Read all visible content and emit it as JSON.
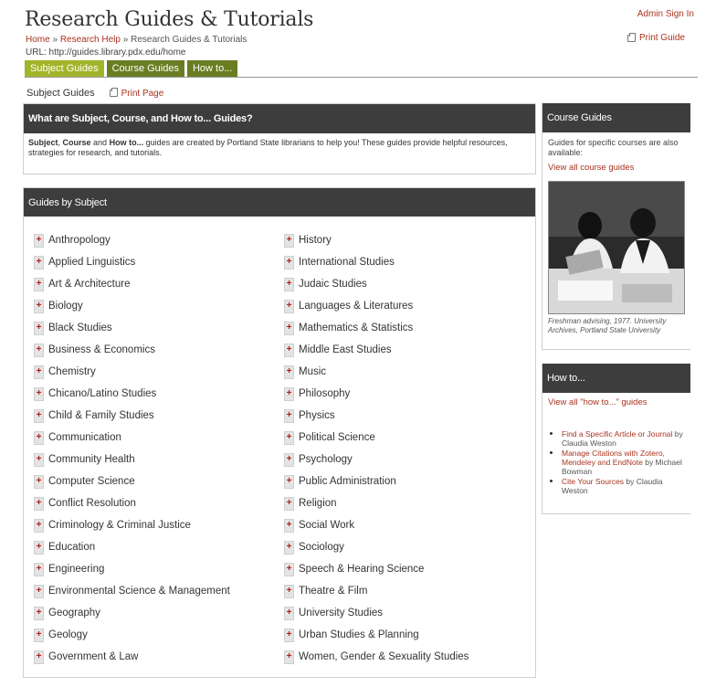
{
  "header": {
    "title": "Research Guides & Tutorials",
    "breadcrumb": {
      "home": "Home",
      "sep1": " » ",
      "research_help": "Research Help",
      "sep2": " » ",
      "current": "Research Guides & Tutorials"
    },
    "url": "URL: http://guides.library.pdx.edu/home",
    "admin_signin": "Admin Sign In",
    "print_guide": "Print Guide"
  },
  "tabs": [
    {
      "label": "Subject Guides",
      "active": true
    },
    {
      "label": "Course Guides",
      "active": false
    },
    {
      "label": "How to...",
      "active": false
    }
  ],
  "subnav": {
    "current": "Subject Guides",
    "print_page": "Print Page"
  },
  "intro": {
    "title": "What are Subject, Course, and How to... Guides?",
    "b1": "Subject",
    "t1": ", ",
    "b2": "Course",
    "t2": " and ",
    "b3": "How to...",
    "t3": " guides are created by Portland State librarians to help you! These guides provide helpful resources, strategies for research, and tutorials."
  },
  "subjects": {
    "title": "Guides by Subject",
    "left": [
      "Anthropology",
      "Applied Linguistics",
      "Art & Architecture",
      "Biology",
      "Black Studies",
      "Business & Economics",
      "Chemistry",
      "Chicano/Latino Studies",
      "Child & Family Studies",
      "Communication",
      "Community Health",
      "Computer Science",
      "Conflict Resolution",
      "Criminology & Criminal Justice",
      "Education",
      "Engineering",
      "Environmental Science & Management",
      "Geography",
      "Geology",
      "Government & Law"
    ],
    "right": [
      "History",
      "International Studies",
      "Judaic Studies",
      "Languages & Literatures",
      "Mathematics & Statistics",
      "Middle East Studies",
      "Music",
      "Philosophy",
      "Physics",
      "Political Science",
      "Psychology",
      "Public Administration",
      "Religion",
      "Social Work",
      "Sociology",
      "Speech & Hearing Science",
      "Theatre & Film",
      "University Studies",
      "Urban Studies & Planning",
      "Women, Gender & Sexuality Studies"
    ],
    "plus": "+"
  },
  "course_guides": {
    "title": "Course Guides",
    "text": "Guides for specific courses are also available:",
    "link": "View all course guides",
    "caption": "Freshman advising, 1977. University Archives, Portland State University"
  },
  "howto": {
    "title": "How to...",
    "link": "View all \"how to...\" guides",
    "items": [
      {
        "link": "Find a Specific Article or Journal",
        "author": "by Claudia Weston"
      },
      {
        "link": "Manage Citations with Zotero, Mendeley and EndNote",
        "author": "by Michael Bowman"
      },
      {
        "link": "Cite Your Sources",
        "author": "by Claudia Weston"
      }
    ]
  },
  "colors": {
    "accent_link": "#a8331e",
    "tab_dark": "#6b7d22",
    "tab_active": "#a2b52a",
    "box_header": "#3d3d3d"
  }
}
